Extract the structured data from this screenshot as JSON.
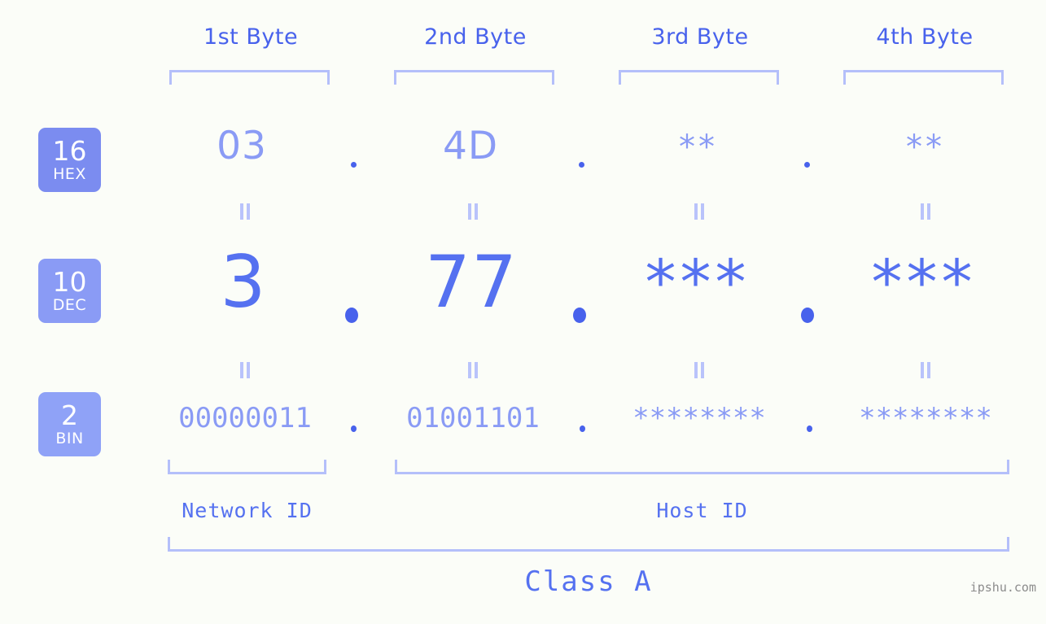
{
  "watermark": "ipshu.com",
  "accent": {
    "strong": "#4862ec",
    "value": "#5571f0",
    "light": "#8a9bf5",
    "bracket": "#b4bffa",
    "badge_bg": "#8a9bf5",
    "background": "#fbfdf8"
  },
  "byte_headers": [
    {
      "label": "1st Byte"
    },
    {
      "label": "2nd Byte"
    },
    {
      "label": "3rd Byte"
    },
    {
      "label": "4th Byte"
    }
  ],
  "bases": [
    {
      "num": "16",
      "name": "HEX"
    },
    {
      "num": "10",
      "name": "DEC"
    },
    {
      "num": "2",
      "name": "BIN"
    }
  ],
  "rows": {
    "hex": {
      "base_num": "16",
      "base_name": "HEX",
      "values": [
        "03",
        "4D",
        "**",
        "**"
      ],
      "separators": [
        ".",
        ".",
        "."
      ]
    },
    "dec": {
      "base_num": "10",
      "base_name": "DEC",
      "values": [
        "3",
        "77",
        "***",
        "***"
      ],
      "separators": [
        ".",
        ".",
        "."
      ]
    },
    "bin": {
      "base_num": "2",
      "base_name": "BIN",
      "values": [
        "00000011",
        "01001101",
        "********",
        "********"
      ],
      "separators": [
        ".",
        ".",
        "."
      ]
    }
  },
  "equals_marker": "=",
  "segments": {
    "network_id": "Network ID",
    "host_id": "Host ID"
  },
  "class": {
    "label": "Class A"
  }
}
